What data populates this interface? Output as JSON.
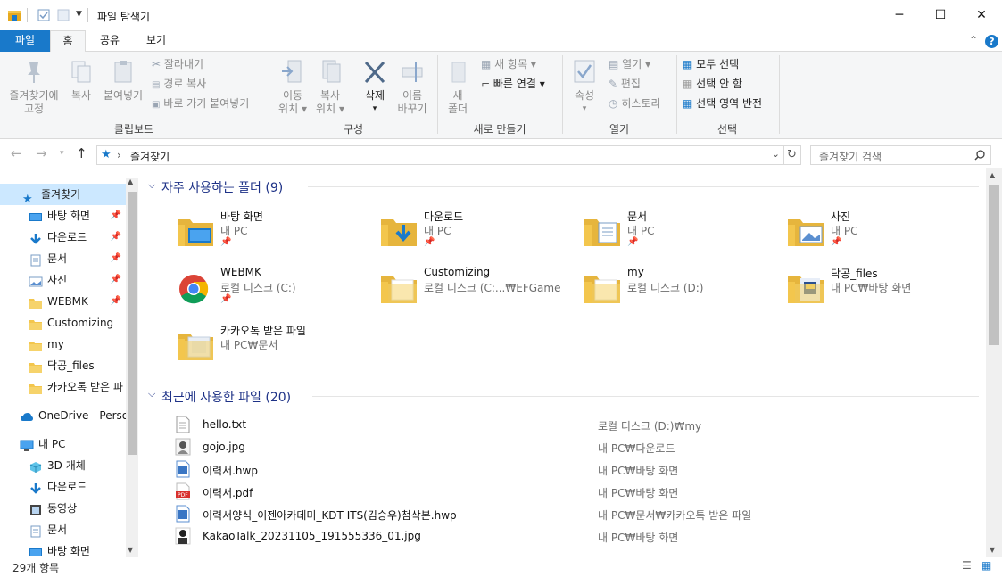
{
  "titlebar": {
    "title": "파일 탐색기",
    "minimize": "─",
    "maximize": "☐",
    "close": "✕"
  },
  "tabs": [
    {
      "label": "파일"
    },
    {
      "label": "홈"
    },
    {
      "label": "공유"
    },
    {
      "label": "보기"
    }
  ],
  "ribbon": {
    "clipboard": {
      "pin_label_1": "즐겨찾기에",
      "pin_label_2": "고정",
      "copy_label": "복사",
      "paste_label": "붙여넣기",
      "cut_label": "잘라내기",
      "copy_path_label": "경로 복사",
      "paste_shortcut_label": "바로 가기 붙여넣기",
      "group_label": "클립보드"
    },
    "organize": {
      "move_label_1": "이동",
      "move_label_2": "위치",
      "copyto_label_1": "복사",
      "copyto_label_2": "위치",
      "delete_label": "삭제",
      "rename_label_1": "이름",
      "rename_label_2": "바꾸기",
      "group_label": "구성"
    },
    "new": {
      "new_folder_label_1": "새",
      "new_folder_label_2": "폴더",
      "new_item_label": "새 항목",
      "easy_access_label": "빠른 연결",
      "group_label": "새로 만들기"
    },
    "open": {
      "properties_label": "속성",
      "open_label": "열기",
      "edit_label": "편집",
      "history_label": "히스토리",
      "group_label": "열기"
    },
    "select": {
      "select_all_label": "모두 선택",
      "select_none_label": "선택 안 함",
      "invert_label": "선택 영역 반전",
      "group_label": "선택"
    }
  },
  "address": {
    "path": "즐겨찾기",
    "search_placeholder": "즐겨찾기 검색"
  },
  "nav": {
    "items": [
      {
        "label": "즐겨찾기",
        "icon": "star-icon"
      },
      {
        "label": "바탕 화면",
        "icon": "desktop-icon"
      },
      {
        "label": "다운로드",
        "icon": "download-icon"
      },
      {
        "label": "문서",
        "icon": "document-icon"
      },
      {
        "label": "사진",
        "icon": "picture-icon"
      },
      {
        "label": "WEBMK",
        "icon": "folder-icon"
      },
      {
        "label": "Customizing",
        "icon": "folder-icon"
      },
      {
        "label": "my",
        "icon": "folder-icon"
      },
      {
        "label": "닥공_files",
        "icon": "folder-icon"
      },
      {
        "label": "카카오톡 받은 파",
        "icon": "folder-icon"
      },
      {
        "label": "OneDrive - Person",
        "icon": "cloud-icon"
      },
      {
        "label": "내 PC",
        "icon": "pc-icon"
      },
      {
        "label": "3D 개체",
        "icon": "cube-icon"
      },
      {
        "label": "다운로드",
        "icon": "download-icon"
      },
      {
        "label": "동영상",
        "icon": "video-icon"
      },
      {
        "label": "문서",
        "icon": "document-icon"
      },
      {
        "label": "바탕 화면",
        "icon": "desktop-icon"
      }
    ]
  },
  "frequent": {
    "header": "자주 사용하는 폴더 (9)",
    "folders": [
      {
        "name": "바탕 화면",
        "sub": "내 PC"
      },
      {
        "name": "다운로드",
        "sub": "내 PC"
      },
      {
        "name": "문서",
        "sub": "내 PC"
      },
      {
        "name": "사진",
        "sub": "내 PC"
      },
      {
        "name": "WEBMK",
        "sub": "로컬 디스크 (C:)"
      },
      {
        "name": "Customizing",
        "sub": "로컬 디스크 (C:...₩EFGame"
      },
      {
        "name": "my",
        "sub": "로컬 디스크 (D:)"
      },
      {
        "name": "닥공_files",
        "sub": "내 PC₩바탕 화면"
      },
      {
        "name": "카카오톡 받은 파일",
        "sub": "내 PC₩문서"
      }
    ]
  },
  "recent": {
    "header": "최근에 사용한 파일 (20)",
    "files": [
      {
        "name": "hello.txt",
        "path": "로컬 디스크 (D:)₩my"
      },
      {
        "name": "gojo.jpg",
        "path": "내 PC₩다운로드"
      },
      {
        "name": "이력서.hwp",
        "path": "내 PC₩바탕 화면"
      },
      {
        "name": "이력서.pdf",
        "path": "내 PC₩바탕 화면"
      },
      {
        "name": "이력서양식_이젠아카데미_KDT ITS(김승우)첨삭본.hwp",
        "path": "내 PC₩문서₩카카오톡 받은 파일"
      },
      {
        "name": "KakaoTalk_20231105_191555336_01.jpg",
        "path": "내 PC₩바탕 화면"
      }
    ]
  },
  "status": {
    "count": "29개 항목"
  },
  "colors": {
    "accent": "#1979ca",
    "folder": "#f6d36b",
    "header": "#1e3287",
    "selection": "#cce8ff"
  }
}
